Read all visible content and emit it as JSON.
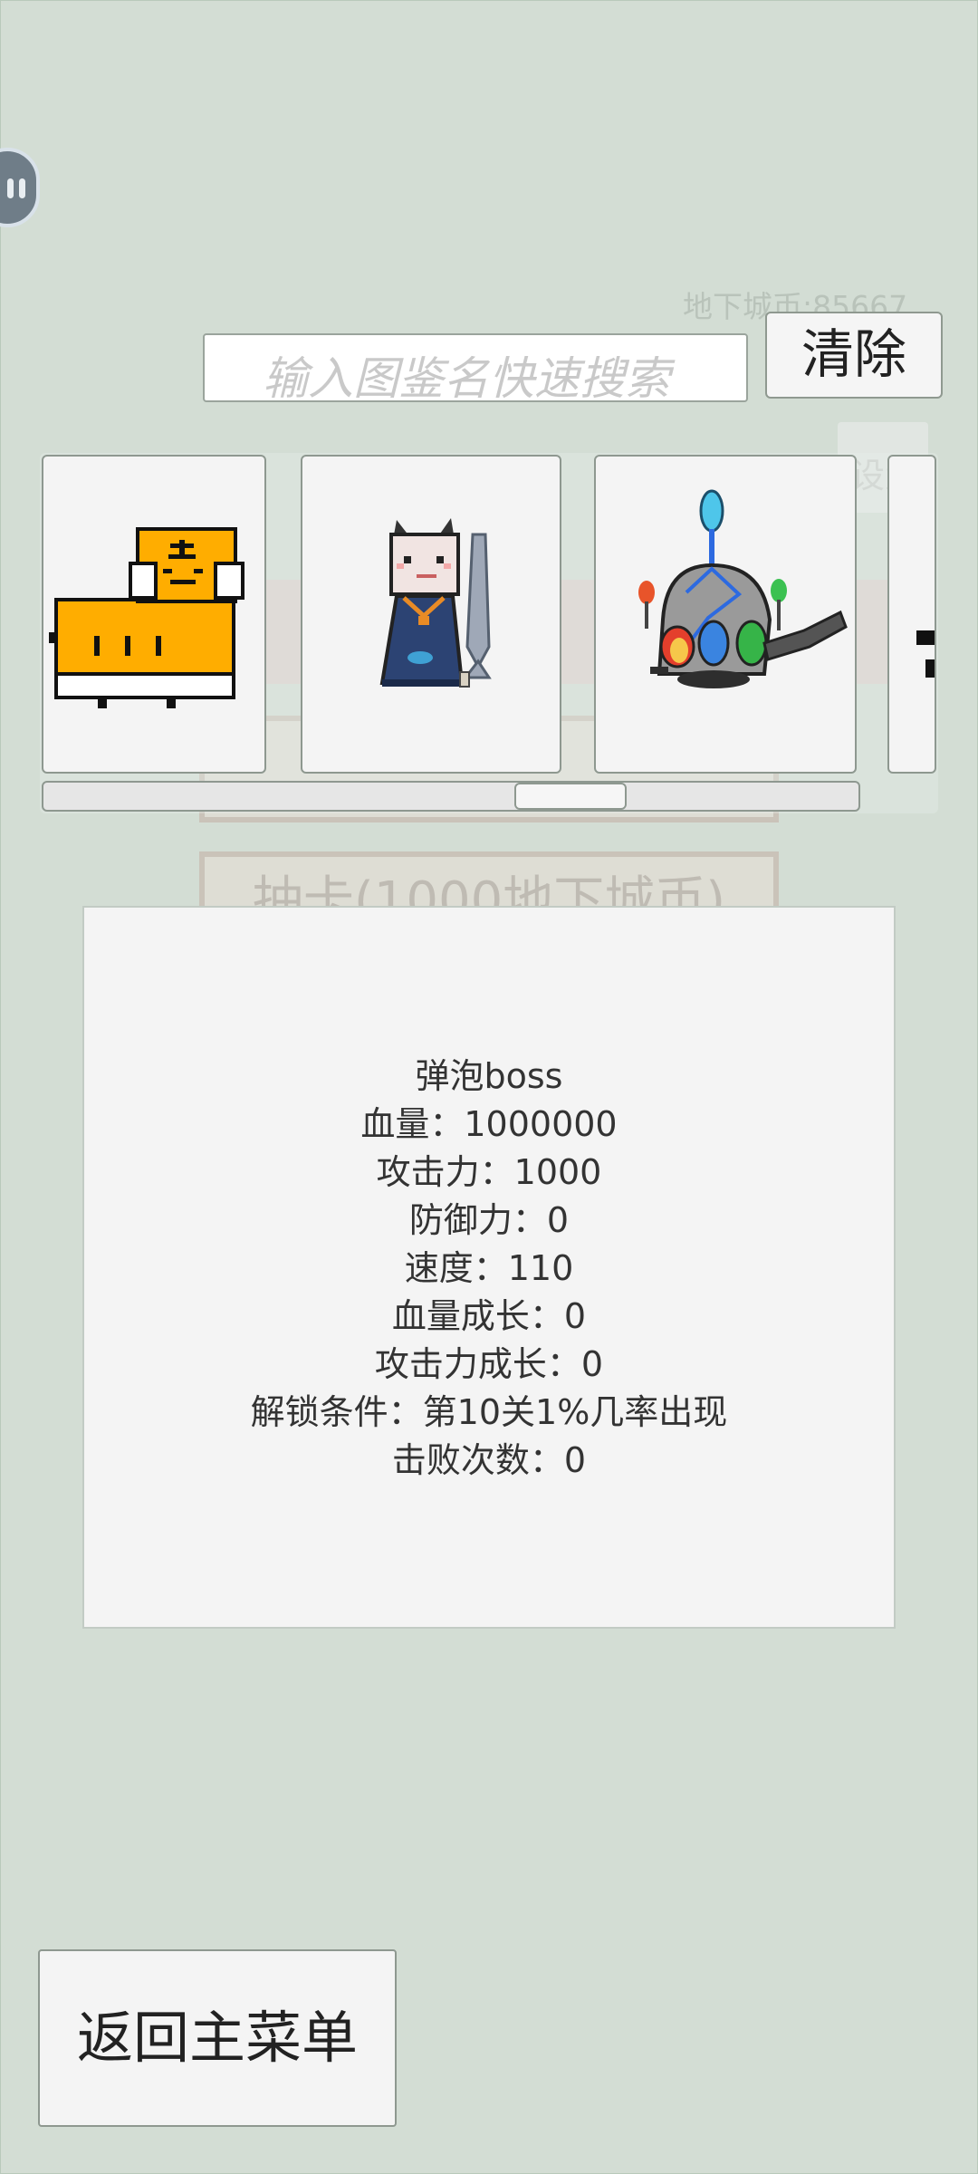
{
  "currency": {
    "label": "地下城币:85667"
  },
  "background": {
    "button_text": "抽卡(1000地下城币)",
    "small_button_text": "设置"
  },
  "search": {
    "placeholder": "输入图鉴名快速搜索"
  },
  "clear_button": {
    "label": "清除"
  },
  "gallery": {
    "cards": [
      {
        "icon": "tiger-box-creature-icon"
      },
      {
        "icon": "cat-with-fish-creature-icon"
      },
      {
        "icon": "bubble-boss-creature-icon"
      },
      {
        "icon": "partial-creature-icon"
      }
    ],
    "scroll_position": 0.67
  },
  "details": {
    "name": "弹泡boss",
    "hp": "血量：1000000",
    "attack": "攻击力：1000",
    "defense": "防御力：0",
    "speed": "速度：110",
    "hp_growth": "血量成长：0",
    "attack_growth": "攻击力成长：0",
    "unlock": "解锁条件：第10关1%几率出现",
    "defeats": "击败次数：0"
  },
  "back_button": {
    "label": "返回主菜单"
  },
  "colors": {
    "background": "#d3ddd4",
    "card": "#f4f4f4",
    "tiger_orange": "#ffad00",
    "cat_robe": "#2c4373"
  }
}
